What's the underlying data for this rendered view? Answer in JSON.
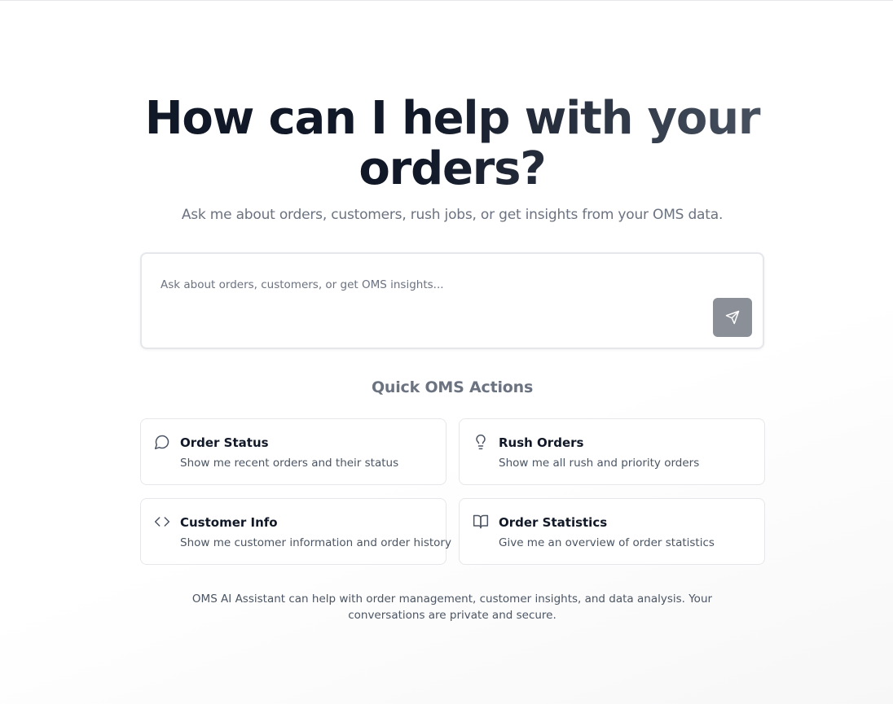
{
  "hero": {
    "title": "How can I help with your orders?",
    "subtitle": "Ask me about orders, customers, rush jobs, or get insights from your OMS data."
  },
  "composer": {
    "placeholder": "Ask about orders, customers, or get OMS insights...",
    "value": "",
    "send_icon": "send-icon"
  },
  "quick_actions": {
    "title": "Quick OMS Actions",
    "items": [
      {
        "icon": "message-circle-icon",
        "title": "Order Status",
        "description": "Show me recent orders and their status"
      },
      {
        "icon": "lightbulb-icon",
        "title": "Rush Orders",
        "description": "Show me all rush and priority orders"
      },
      {
        "icon": "code-icon",
        "title": "Customer Info",
        "description": "Show me customer information and order history"
      },
      {
        "icon": "book-open-icon",
        "title": "Order Statistics",
        "description": "Give me an overview of order statistics"
      }
    ]
  },
  "footer": {
    "note": "OMS AI Assistant can help with order management, customer insights, and data analysis. Your conversations are private and secure."
  },
  "colors": {
    "send_button": "#8a8f98",
    "title_dark": "#111827",
    "muted_text": "#6b7280",
    "border": "#e5e7eb"
  }
}
